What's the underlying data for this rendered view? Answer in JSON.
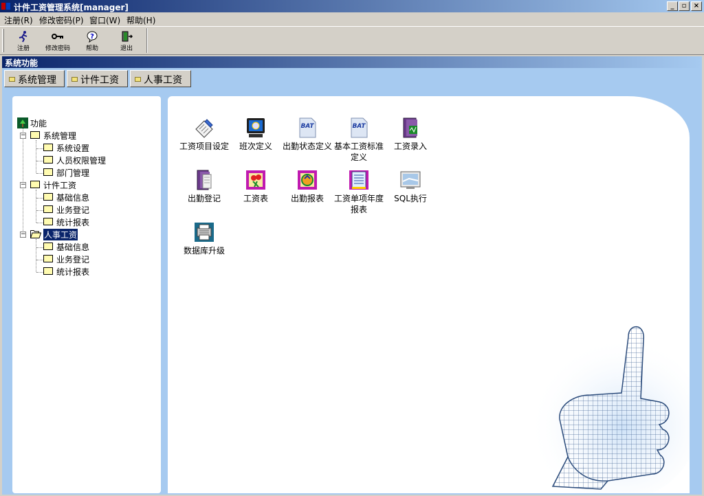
{
  "window": {
    "title": "计件工资管理系统[manager]",
    "controls": [
      "_",
      "▫",
      "×"
    ]
  },
  "menu": [
    "注册(R)",
    "修改密码(P)",
    "窗口(W)",
    "帮助(H)"
  ],
  "toolbar": {
    "register": "注册",
    "change_password": "修改密码",
    "help": "帮助",
    "exit": "退出"
  },
  "panel": {
    "caption": "系统功能"
  },
  "tabs": [
    "系统管理",
    "计件工资",
    "人事工资"
  ],
  "tree": {
    "root": "功能",
    "groups": [
      {
        "label": "系统管理",
        "children": [
          "系统设置",
          "人员权限管理",
          "部门管理"
        ]
      },
      {
        "label": "计件工资",
        "children": [
          "基础信息",
          "业务登记",
          "统计报表"
        ]
      },
      {
        "label": "人事工资",
        "children": [
          "基础信息",
          "业务登记",
          "统计报表"
        ]
      }
    ],
    "selected": "人事工资"
  },
  "functions": [
    {
      "label": "工资项目设定",
      "icon": "form-pen-icon"
    },
    {
      "label": "班次定义",
      "icon": "monitor-icon"
    },
    {
      "label": "出勤状态定义",
      "icon": "bat-file-icon"
    },
    {
      "label": "基本工资标准定义",
      "icon": "bat-file-icon"
    },
    {
      "label": "工资录入",
      "icon": "binder-icon"
    },
    {
      "label": "出勤登记",
      "icon": "document-binder-icon"
    },
    {
      "label": "工资表",
      "icon": "flower-card-icon"
    },
    {
      "label": "出勤报表",
      "icon": "recycle-card-icon"
    },
    {
      "label": "工资单项年度报表",
      "icon": "report-sheet-icon"
    },
    {
      "label": "SQL执行",
      "icon": "display-icon"
    },
    {
      "label": "数据库升级",
      "icon": "printer-icon"
    }
  ],
  "colors": {
    "titlebar_start": "#0a246a",
    "titlebar_end": "#a6caf0",
    "workspace": "#a6caf0",
    "selection": "#0a246a"
  }
}
